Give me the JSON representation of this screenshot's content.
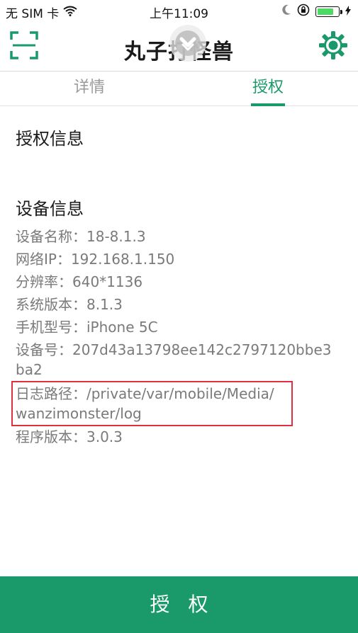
{
  "status_bar": {
    "carrier": "无 SIM 卡",
    "time": "上午11:09"
  },
  "nav": {
    "title": "丸子打怪兽"
  },
  "tabs": [
    {
      "label": "详情",
      "active": false
    },
    {
      "label": "授权",
      "active": true
    }
  ],
  "sections": {
    "auth_info_title": "授权信息",
    "device_info_title": "设备信息"
  },
  "device_info": {
    "device_name": "设备名称：18-8.1.3",
    "network_ip": "网络IP：192.168.1.150",
    "resolution": "分辨率：640*1136",
    "system_version": "系统版本：8.1.3",
    "phone_model": "手机型号：iPhone 5C",
    "device_id_line1": "设备号：207d43a13798ee142c2797120bbe3",
    "device_id_line2": "ba2",
    "log_path_line1": "日志路径：/private/var/mobile/Media/",
    "log_path_line2": "wanzimonster/log",
    "app_version": "程序版本：3.0.3"
  },
  "bottom_button": {
    "label": "授权"
  },
  "colors": {
    "accent": "#1a9a6a",
    "highlight_box": "#e03040",
    "battery": "#4cd964"
  },
  "icons": {
    "scan": "scan-frame-icon",
    "settings": "gear-icon",
    "pull_refresh": "chevron-down-icon",
    "wifi": "wifi-icon",
    "moon": "moon-icon",
    "lock_rotation": "rotation-lock-icon",
    "charging": "bolt-icon"
  }
}
